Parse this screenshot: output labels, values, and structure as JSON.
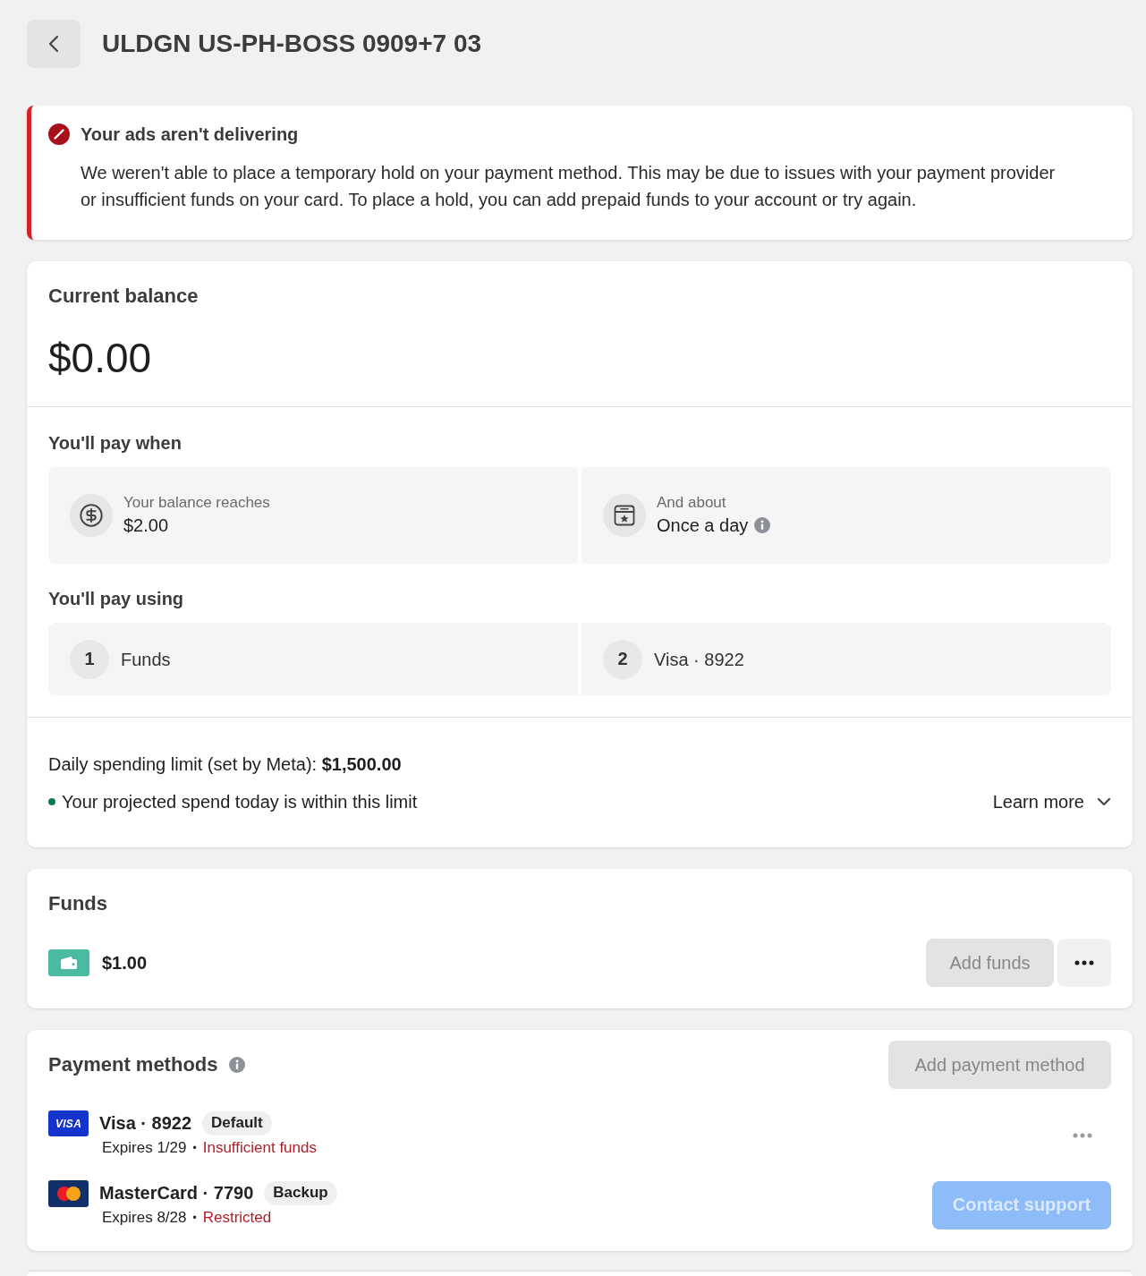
{
  "header": {
    "title": "ULDGN US-PH-BOSS 0909+7 03"
  },
  "alert": {
    "error": true,
    "title": "Your ads aren't delivering",
    "body": "We weren't able to place a temporary hold on your payment method. This may be due to issues with your payment provider or insufficient funds on your card. To place a hold, you can add prepaid funds to your account or try again."
  },
  "balance": {
    "title": "Current balance",
    "amount": "$0.00"
  },
  "pay_when": {
    "title": "You'll pay when",
    "items": [
      {
        "kind": "threshold",
        "label": "Your balance reaches",
        "value": "$2.00",
        "info": false
      },
      {
        "kind": "schedule",
        "label": "And about",
        "value": "Once a day",
        "info": true
      }
    ]
  },
  "pay_using": {
    "title": "You'll pay using",
    "items": [
      {
        "number": "1",
        "label": "Funds"
      },
      {
        "number": "2",
        "label": "Visa · 8922"
      }
    ]
  },
  "spending_limit": {
    "text": "Daily spending limit (set by Meta): **$1,500.00**",
    "within_limit": true,
    "status_text": "Your projected spend today is within this limit",
    "link": {
      "label": "Learn more",
      "expanded": false
    }
  },
  "funds": {
    "title": "Funds",
    "amount": "$1.00",
    "add_button": {
      "label": "Add funds",
      "disabled": true
    },
    "more_button": {
      "disabled": false
    }
  },
  "payment_methods": {
    "title": "Payment methods",
    "info": true,
    "add_button": {
      "label": "Add payment method",
      "disabled": true
    },
    "methods": [
      {
        "kind": "visa",
        "logo_text": "VISA",
        "name": "Visa · 8922",
        "badge": "Default",
        "expiry": "Expires 1/29",
        "separator": "•",
        "status": "Insufficient funds",
        "action": {
          "kind": "more",
          "disabled": true
        }
      },
      {
        "kind": "mastercard",
        "name": "MasterCard · 7790",
        "badge": "Backup",
        "expiry": "Expires 8/28",
        "separator": "•",
        "status": "Restricted",
        "action": {
          "kind": "button",
          "label": "Contact support",
          "disabled": true
        }
      }
    ]
  }
}
